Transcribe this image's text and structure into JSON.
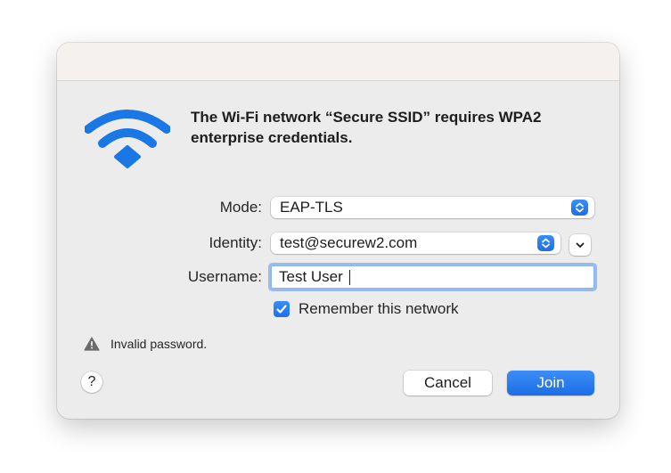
{
  "dialog": {
    "message_line1": "The Wi-Fi network “Secure SSID” requires WPA2",
    "message_line2": "enterprise credentials.",
    "icon": "wifi-icon"
  },
  "form": {
    "mode": {
      "label": "Mode:",
      "value": "EAP-TLS"
    },
    "identity": {
      "label": "Identity:",
      "value": "test@securew2.com"
    },
    "username": {
      "label": "Username:",
      "value": "Test User"
    },
    "remember": {
      "label": "Remember this network",
      "checked": true
    }
  },
  "warning": {
    "icon": "warning-triangle-icon",
    "text": "Invalid password."
  },
  "buttons": {
    "help": "?",
    "cancel": "Cancel",
    "join": "Join"
  },
  "colors": {
    "accent": "#1e6ee8",
    "wifi": "#1a78e6",
    "dialog_bg": "#ececec"
  }
}
